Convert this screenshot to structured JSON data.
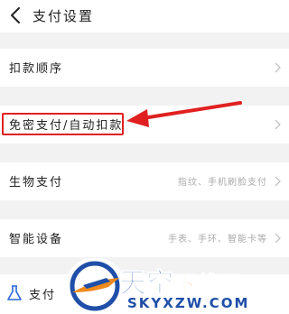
{
  "header": {
    "title": "支付设置"
  },
  "settings": [
    {
      "label": "扣款顺序",
      "value": ""
    },
    {
      "label": "免密支付/自动扣款",
      "value": ""
    },
    {
      "label": "生物支付",
      "value": "指纹、手机刷脸支付"
    },
    {
      "label": "智能设备",
      "value": "手表、手环、智能卡等"
    }
  ],
  "partial_row": {
    "label": "支付"
  },
  "watermark": {
    "brand_blue": "天空",
    "brand_orange": "下载玩",
    "url": "SKYXZW.COM"
  },
  "colors": {
    "highlight": "#e02020",
    "brand_blue": "#1f4fa8",
    "brand_orange": "#f08a1c"
  }
}
